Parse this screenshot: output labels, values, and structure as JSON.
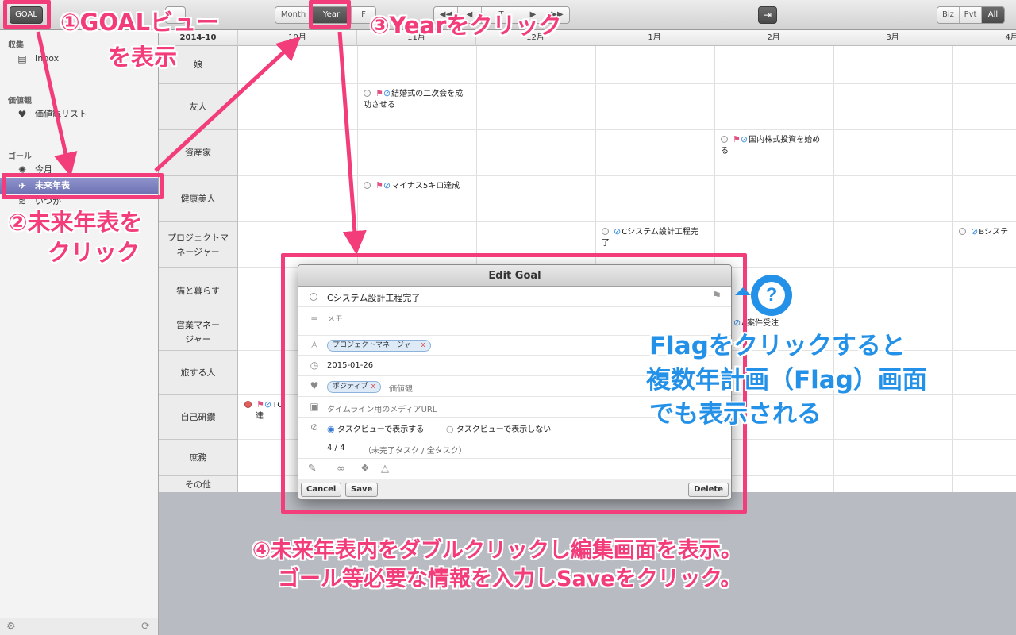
{
  "toolbar": {
    "goal_button": "GOAL",
    "view_month": "Month",
    "view_year": "Year",
    "view_f": "F",
    "nav_prev2": "◀◀",
    "nav_prev": "◀",
    "nav_today": "T",
    "nav_next": "▶",
    "nav_next2": "▶▶",
    "filter_biz": "Biz",
    "filter_pvt": "Pvt",
    "filter_all": "All",
    "export_icon": "export-icon"
  },
  "sidebar": {
    "section_collect": "収集",
    "inbox": "Inbox",
    "section_values": "価値観",
    "values_list": "価値観リスト",
    "section_goal": "ゴール",
    "goal_this_month": "今月",
    "goal_future": "未来年表",
    "goal_someday": "いつか"
  },
  "grid": {
    "corner": "2014-10",
    "months": [
      "10月",
      "11月",
      "12月",
      "1月",
      "2月",
      "3月",
      "4月"
    ],
    "rows": [
      "娘",
      "友人",
      "資産家",
      "健康美人",
      "プロジェクトマネージャー",
      "猫と暮らす",
      "営業マネージャー",
      "旅する人",
      "自己研鑽",
      "庶務",
      "その他"
    ],
    "goals": {
      "wedding": "結婚式の二次会を成功させる",
      "invest": "国内株式投資を始める",
      "diet": "マイナス5キロ達成",
      "csys": "Cシステム設計工程完了",
      "bsys": "Bシステ",
      "anken": "A案件受注",
      "study_tail": "達",
      "study_head": "TO"
    }
  },
  "dialog": {
    "title": "Edit Goal",
    "goal_name": "Cシステム設計工程完了",
    "memo_placeholder": "メモ",
    "role_tag": "プロジェクトマネージャー",
    "tag_remove": "x",
    "date": "2015-01-26",
    "value_tag": "ポジティブ",
    "value_label": "価値観",
    "media_placeholder": "タイムライン用のメディアURL",
    "radio_show": "タスクビューで表示する",
    "radio_hide": "タスクビューで表示しない",
    "task_count": "4 / 4",
    "task_count_label": "（未完了タスク / 全タスク）",
    "cancel": "Cancel",
    "save": "Save",
    "delete": "Delete"
  },
  "annotations": {
    "step1": "①GOALビュー",
    "step1b": "を表示",
    "step2": "②未来年表を",
    "step2b": "クリック",
    "step3": "③Yearをクリック",
    "step4": "④未来年表内をダブルクリックし編集画面を表示。",
    "step4b": "ゴール等必要な情報を入力しSaveをクリック。",
    "flag_note_1": "Flagをクリックすると",
    "flag_note_2": "複数年計画（Flag）画面",
    "flag_note_3": "でも表示される",
    "help_mark": "?"
  },
  "colors": {
    "annotation_pink": "#f23d7a",
    "annotation_blue": "#2491e8",
    "sidebar_active": "#7a7ebd"
  }
}
